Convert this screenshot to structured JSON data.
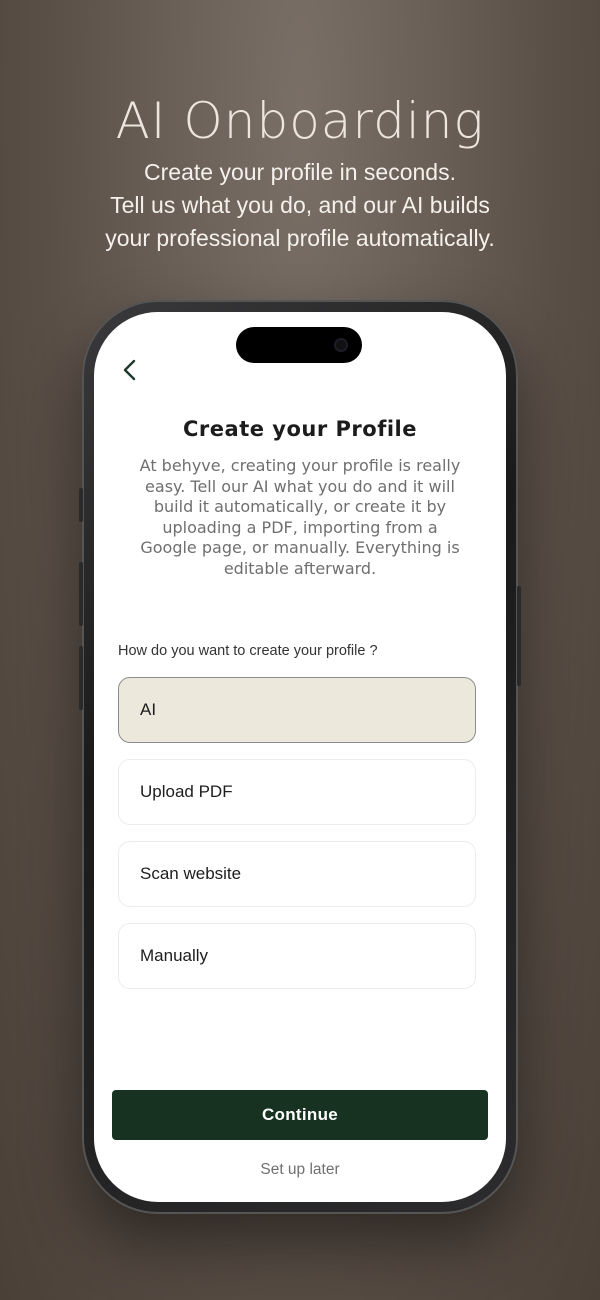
{
  "hero": {
    "title": "AI Onboarding",
    "subtitle_lines": [
      "Create your profile in seconds.",
      "Tell us what you do, and our AI builds",
      "your professional profile automatically."
    ]
  },
  "screen": {
    "back_icon": "chevron-left-icon",
    "title": "Create your Profile",
    "description": "At behyve, creating your profile is really easy. Tell our AI what you do and it will build it automatically, or create it by uploading a PDF, importing from a Google page, or manually. Everything is editable afterward.",
    "question": "How do you want to create your profile ?",
    "options": [
      {
        "label": "AI",
        "selected": true
      },
      {
        "label": "Upload PDF",
        "selected": false
      },
      {
        "label": "Scan website",
        "selected": false
      },
      {
        "label": "Manually",
        "selected": false
      }
    ],
    "continue_label": "Continue",
    "later_label": "Set up later"
  },
  "colors": {
    "primary_button": "#173220",
    "selected_option": "#ede8dc",
    "back_icon": "#1e3a2c"
  }
}
